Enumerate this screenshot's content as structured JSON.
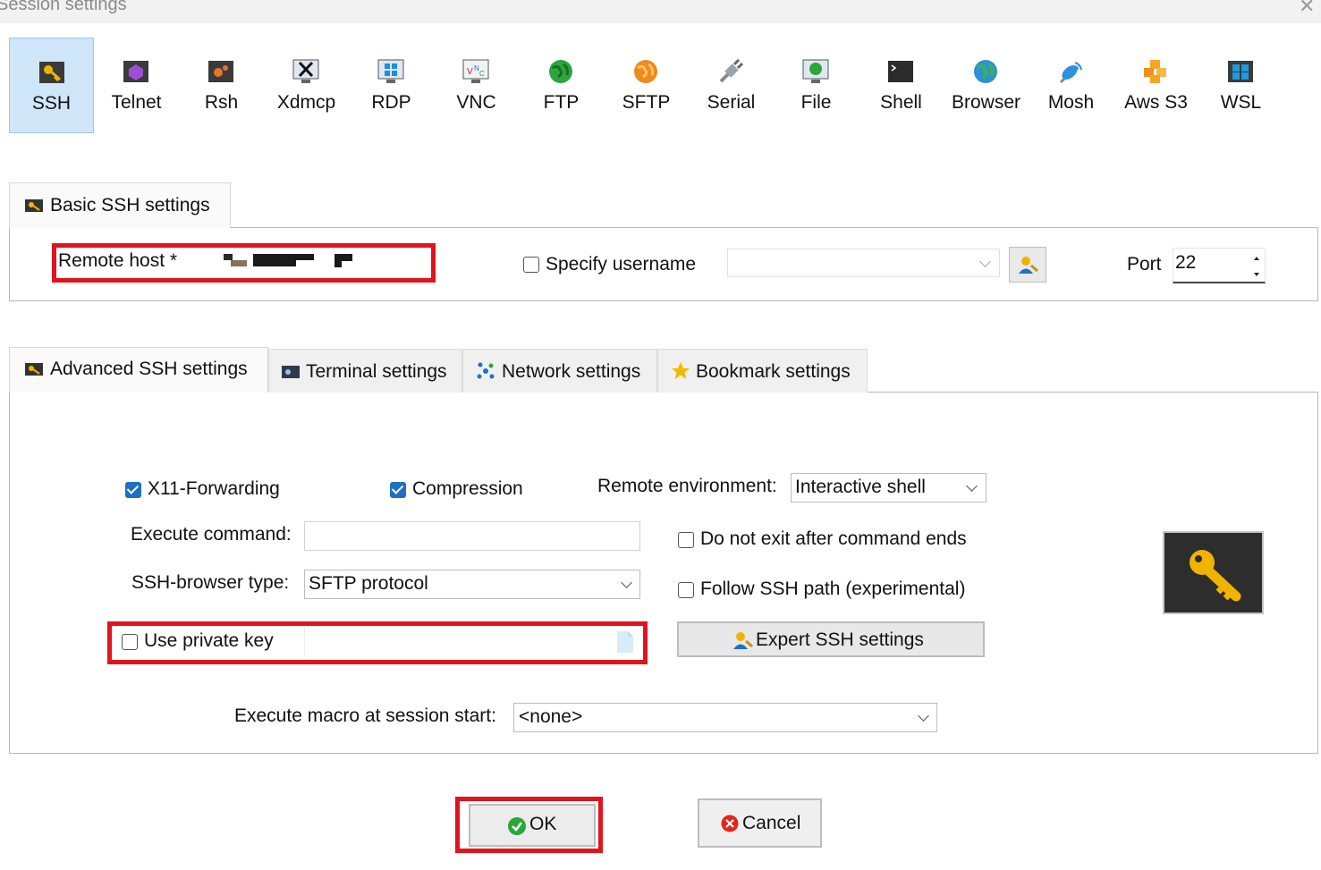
{
  "window": {
    "title": "Session settings",
    "close_glyph": "✕"
  },
  "session_types": [
    {
      "label": "SSH",
      "icon": "ssh-key-icon",
      "selected": true
    },
    {
      "label": "Telnet",
      "icon": "telnet-icon"
    },
    {
      "label": "Rsh",
      "icon": "rsh-icon"
    },
    {
      "label": "Xdmcp",
      "icon": "xdmcp-icon"
    },
    {
      "label": "RDP",
      "icon": "rdp-icon"
    },
    {
      "label": "VNC",
      "icon": "vnc-icon"
    },
    {
      "label": "FTP",
      "icon": "ftp-globe-icon"
    },
    {
      "label": "SFTP",
      "icon": "sftp-globe-icon"
    },
    {
      "label": "Serial",
      "icon": "serial-plug-icon"
    },
    {
      "label": "File",
      "icon": "file-monitor-icon"
    },
    {
      "label": "Shell",
      "icon": "shell-terminal-icon"
    },
    {
      "label": "Browser",
      "icon": "browser-globe-icon"
    },
    {
      "label": "Mosh",
      "icon": "mosh-satellite-icon"
    },
    {
      "label": "Aws S3",
      "icon": "aws-cubes-icon"
    },
    {
      "label": "WSL",
      "icon": "windows-icon"
    }
  ],
  "basic": {
    "tab_label": "Basic SSH settings",
    "remote_host_label": "Remote host *",
    "remote_host_value": "",
    "specify_username_label": "Specify username",
    "specify_username_checked": false,
    "username_value": "",
    "port_label": "Port",
    "port_value": "22"
  },
  "advanced_tabs": [
    {
      "label": "Advanced SSH settings",
      "active": true
    },
    {
      "label": "Terminal settings"
    },
    {
      "label": "Network settings"
    },
    {
      "label": "Bookmark settings"
    }
  ],
  "advanced": {
    "x11_label": "X11-Forwarding",
    "x11_checked": true,
    "compression_label": "Compression",
    "compression_checked": true,
    "remote_env_label": "Remote environment:",
    "remote_env_value": "Interactive shell",
    "execute_command_label": "Execute command:",
    "execute_command_value": "",
    "no_exit_label": "Do not exit after command ends",
    "no_exit_checked": false,
    "browser_type_label": "SSH-browser type:",
    "browser_type_value": "SFTP protocol",
    "follow_path_label": "Follow SSH path (experimental)",
    "follow_path_checked": false,
    "private_key_label": "Use private key",
    "private_key_checked": false,
    "private_key_value": "",
    "expert_button_label": "Expert SSH settings",
    "macro_label": "Execute macro at session start:",
    "macro_value": "<none>"
  },
  "buttons": {
    "ok_label": "OK",
    "cancel_label": "Cancel"
  },
  "colors": {
    "accent": "#1f6fc4",
    "highlight": "#e0141e",
    "selected_bg": "#cfe5f8"
  }
}
